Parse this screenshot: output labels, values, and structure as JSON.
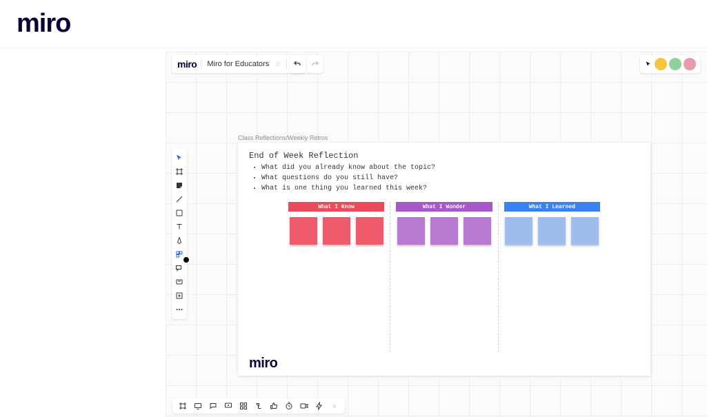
{
  "brand": {
    "logo": "miro"
  },
  "board": {
    "logo": "miro",
    "name": "Miro for Educators"
  },
  "collaborators": {
    "colors": [
      "#f5c542",
      "#8fd19e",
      "#e89aad"
    ]
  },
  "frame": {
    "label": "Class Reflections/Weekly Retros",
    "title": "End of Week Reflection",
    "bullets": [
      "What did you already know about the topic?",
      "What questions do you still have?",
      "What is one thing you learned this week?"
    ],
    "columns": [
      {
        "header": "What I Know",
        "colorClass": "c-red",
        "stickyClass": "red"
      },
      {
        "header": "What I Wonder",
        "colorClass": "c-purple",
        "stickyClass": "purple"
      },
      {
        "header": "What I Learned",
        "colorClass": "c-blue",
        "stickyClass": "blue"
      }
    ],
    "footerLogo": "miro"
  },
  "tools": {
    "select": "select",
    "frame": "frame",
    "sticky": "sticky",
    "line": "line",
    "shape": "shape",
    "text": "text",
    "pen": "pen",
    "apps": "apps",
    "comment": "comment",
    "card": "card",
    "upload": "upload",
    "more": "more"
  }
}
